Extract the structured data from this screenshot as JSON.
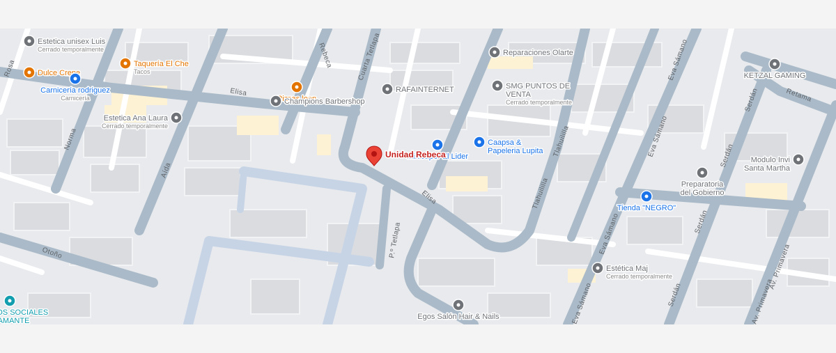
{
  "colors": {
    "block": "#e8eaed",
    "building": "#dadce0",
    "road_main": "#aabac8",
    "road_minor": "#ffffff",
    "plaza": "#c7d4e6",
    "poi_gray": "#6f7378",
    "poi_blue": "#1a73e8",
    "poi_orange": "#e37400",
    "poi_teal": "#129eaf",
    "poi_building_fill": "#fdf2d4",
    "pin_red": "#ea4335",
    "selected_label": "#c5221f"
  },
  "selected_place": {
    "name": "Unidad Rebeca",
    "icon": "map-pin-icon"
  },
  "places": [
    {
      "name": "Estetica unisex Luis",
      "note": "Cerrado temporalmente",
      "icon": "place-pin-icon",
      "color": "gray"
    },
    {
      "name": "Taquería El Che",
      "note": "Tacos",
      "icon": "restaurant-icon",
      "color": "orange"
    },
    {
      "name": "Dulce Crepe",
      "icon": "dessert-icon",
      "color": "orange"
    },
    {
      "name": "Carnicería rodriguez",
      "note": "Carnicería",
      "icon": "shopping-basket-icon",
      "color": "blue"
    },
    {
      "name": "Pizzas leon",
      "icon": "restaurant-icon",
      "color": "orange"
    },
    {
      "name": "Champions Barbershop",
      "icon": "place-pin-icon",
      "color": "gray"
    },
    {
      "name": "Estetica Ana Laura",
      "note": "Cerrado temporalmente",
      "icon": "place-pin-icon",
      "color": "gray"
    },
    {
      "name": "Reparaciones Olarte",
      "icon": "place-pin-icon",
      "color": "gray"
    },
    {
      "name": "RAFAINTERNET",
      "icon": "place-pin-icon",
      "color": "gray"
    },
    {
      "name": "SMG PUNTOS DE",
      "name2": "VENTA",
      "note": "Cerrado temporalmente",
      "icon": "place-pin-icon",
      "color": "gray"
    },
    {
      "name": "Minisuper El Lider",
      "icon": "shopping-basket-icon",
      "color": "blue"
    },
    {
      "name": "Caapsa &",
      "name2": "Papeleria Lupita",
      "icon": "shopping-basket-icon",
      "color": "blue"
    },
    {
      "name": "KETZAL GAMING",
      "icon": "place-pin-icon",
      "color": "gray"
    },
    {
      "name": "Preparatoria",
      "name2": "del Gobierno",
      "icon": "place-pin-icon",
      "color": "gray"
    },
    {
      "name": "Modulo Invi",
      "name2": "Santa Martha",
      "icon": "building-icon",
      "color": "gray"
    },
    {
      "name": "Tienda \"NEGRO\"",
      "icon": "shopping-cart-icon",
      "color": "blue"
    },
    {
      "name": "Estética Maj",
      "note": "Cerrado temporalmente",
      "icon": "place-pin-icon",
      "color": "gray"
    },
    {
      "name": "EVENTOS SOCIALES",
      "name2": "DIAMANTE",
      "icon": "event-icon",
      "color": "teal"
    },
    {
      "name": "Egos Salón Hair & Nails",
      "icon": "place-pin-icon",
      "color": "gray"
    }
  ],
  "streets": [
    "Rosa",
    "Rebeca",
    "Cuarta Tetlapa",
    "Elisa",
    "Norma",
    "Aída",
    "Eva Sámano",
    "Tlahuililla",
    "Retama",
    "Serdán",
    "P.º Tetlapa",
    "Otoño",
    "Av. Primavera"
  ]
}
